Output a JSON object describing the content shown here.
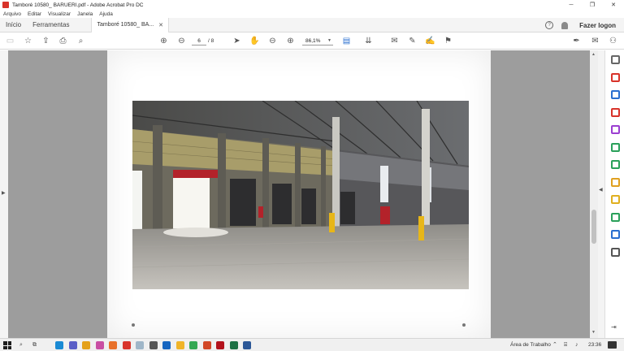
{
  "window": {
    "title": "Tamboré 10580_ BARUERI.pdf - Adobe Acrobat Pro DC",
    "minimize": "─",
    "maximize": "❐",
    "close": "✕"
  },
  "menu": [
    "Arquivo",
    "Editar",
    "Visualizar",
    "Janela",
    "Ajuda"
  ],
  "tabs": {
    "home": "Início",
    "tools": "Ferramentas",
    "document": "Tamboré 10580_ BA...",
    "document_close": "✕",
    "help": "?",
    "login": "Fazer logon"
  },
  "toolbar": {
    "page_current": "6",
    "page_total": "/ 8",
    "zoom": "86,1%"
  },
  "colors": {
    "accent": "#2a6fd0",
    "acrobat_red": "#d8332a"
  },
  "right_pane_icons": [
    {
      "name": "zoom-icon",
      "color": "#666666"
    },
    {
      "name": "create-pdf-icon",
      "color": "#d8332a"
    },
    {
      "name": "export-pdf-icon",
      "color": "#2a6fd0"
    },
    {
      "name": "organize-pages-icon",
      "color": "#d8332a"
    },
    {
      "name": "edit-pdf-icon",
      "color": "#9b3fd1"
    },
    {
      "name": "combine-files-icon",
      "color": "#2aa05a"
    },
    {
      "name": "compress-icon",
      "color": "#2aa05a"
    },
    {
      "name": "fill-sign-icon",
      "color": "#e0a020"
    },
    {
      "name": "comment-icon",
      "color": "#e0b020"
    },
    {
      "name": "print-production-icon",
      "color": "#2aa05a"
    },
    {
      "name": "protect-icon",
      "color": "#2a6fd0"
    },
    {
      "name": "more-tools-icon",
      "color": "#555555"
    }
  ],
  "taskbar": {
    "desktop_label": "Área de Trabalho",
    "clock": "23:36",
    "apps": [
      {
        "name": "edge-taskbar-icon",
        "color": "#1a8ad4"
      },
      {
        "name": "teams-taskbar-icon",
        "color": "#5b5fc7"
      },
      {
        "name": "chrome-taskbar-icon",
        "color": "#e4a11b"
      },
      {
        "name": "paint-taskbar-icon",
        "color": "#c94fa3"
      },
      {
        "name": "firefox-taskbar-icon",
        "color": "#e8702a"
      },
      {
        "name": "acrobat-reader-taskbar-icon",
        "color": "#d8332a"
      },
      {
        "name": "notepad-taskbar-icon",
        "color": "#9fb6c8"
      },
      {
        "name": "calculator-taskbar-icon",
        "color": "#555555"
      },
      {
        "name": "outlook-taskbar-icon",
        "color": "#1565c0"
      },
      {
        "name": "explorer-taskbar-icon",
        "color": "#f0b429"
      },
      {
        "name": "chrome2-taskbar-icon",
        "color": "#34a853"
      },
      {
        "name": "powerpoint-taskbar-icon",
        "color": "#d24726"
      },
      {
        "name": "acrobat-pro-taskbar-icon",
        "color": "#b3121c"
      },
      {
        "name": "excel-taskbar-icon",
        "color": "#1d7044"
      },
      {
        "name": "word-taskbar-icon",
        "color": "#2b5797"
      }
    ]
  }
}
